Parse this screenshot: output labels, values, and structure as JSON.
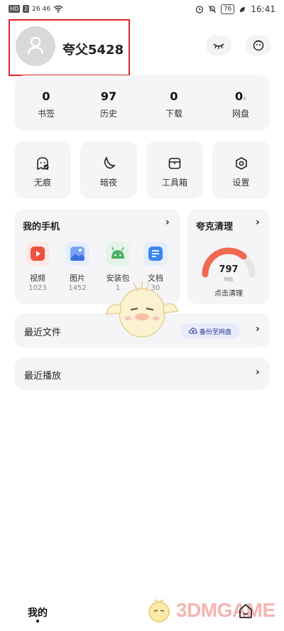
{
  "status_bar": {
    "left_chips": [
      "HD",
      "2"
    ],
    "signal_text": "26  46",
    "battery": "76",
    "time": "16:41",
    "icons": [
      "wifi-icon",
      "alarm-icon",
      "bell-off-icon",
      "battery-icon",
      "leaf-icon"
    ]
  },
  "profile": {
    "username": "夸父5428",
    "avatar_icon": "person-icon"
  },
  "header_actions": [
    {
      "icon": "sleep-eye-icon"
    },
    {
      "icon": "chat-face-icon"
    }
  ],
  "stats": [
    {
      "value": "0",
      "label": "书签"
    },
    {
      "value": "97",
      "label": "历史"
    },
    {
      "value": "0",
      "label": "下载"
    },
    {
      "value": "0",
      "suffix": "B",
      "label": "网盘"
    }
  ],
  "tools": [
    {
      "label": "无痕",
      "icon": "ghost-icon"
    },
    {
      "label": "暗夜",
      "icon": "moon-icon"
    },
    {
      "label": "工具箱",
      "icon": "toolbox-icon"
    },
    {
      "label": "设置",
      "icon": "gear-icon"
    }
  ],
  "my_phone": {
    "title": "我的手机",
    "chevron": "›",
    "apps": [
      {
        "label": "视频",
        "count": "1023",
        "icon": "video-icon",
        "color": "#ef5140"
      },
      {
        "label": "图片",
        "count": "1452",
        "icon": "image-icon",
        "color": "#5a8ef0"
      },
      {
        "label": "安装包",
        "count": "1",
        "icon": "android-icon",
        "color": "#4caf6a"
      },
      {
        "label": "文档",
        "count": "30",
        "icon": "document-icon",
        "color": "#3a86f0"
      }
    ]
  },
  "cleaner": {
    "title": "夸克清理",
    "chevron": "›",
    "size_value": "797",
    "size_unit": "MB",
    "action": "点击清理",
    "gauge_fraction": 0.72,
    "gauge_color": "#f06a50"
  },
  "recent_files": {
    "title": "最近文件",
    "backup_label": "备份至网盘",
    "chevron": "›"
  },
  "recent_play": {
    "title": "最近播放",
    "chevron": "›"
  },
  "bottom_nav": {
    "mine_label": "我的",
    "home_icon": "home-icon"
  },
  "watermark": {
    "text": "3DMGAME"
  },
  "colors": {
    "card_bg": "#f5f5f7",
    "highlight_border": "#e0242a",
    "accent": "#2c3a8c"
  }
}
